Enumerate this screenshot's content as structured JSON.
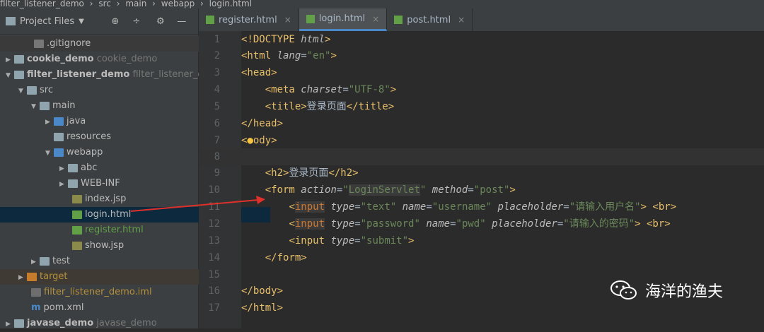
{
  "breadcrumb": {
    "items": [
      "filter_listener_demo",
      "src",
      "main",
      "webapp",
      "login.html"
    ]
  },
  "project_panel": {
    "title": "Project Files",
    "rows": [
      {
        "label": ".gitignore",
        "secondary": ""
      },
      {
        "label": "cookie_demo",
        "secondary": "cookie_demo"
      },
      {
        "label": "filter_listener_demo",
        "secondary": "filter_listener_dem"
      },
      {
        "label": "src",
        "secondary": ""
      },
      {
        "label": "main",
        "secondary": ""
      },
      {
        "label": "java",
        "secondary": ""
      },
      {
        "label": "resources",
        "secondary": ""
      },
      {
        "label": "webapp",
        "secondary": ""
      },
      {
        "label": "abc",
        "secondary": ""
      },
      {
        "label": "WEB-INF",
        "secondary": ""
      },
      {
        "label": "index.jsp",
        "secondary": ""
      },
      {
        "label": "login.html",
        "secondary": ""
      },
      {
        "label": "register.html",
        "secondary": ""
      },
      {
        "label": "show.jsp",
        "secondary": ""
      },
      {
        "label": "test",
        "secondary": ""
      },
      {
        "label": "target",
        "secondary": ""
      },
      {
        "label": "filter_listener_demo.iml",
        "secondary": ""
      },
      {
        "label": "pom.xml",
        "secondary": ""
      },
      {
        "label": "javase_demo",
        "secondary": "javase_demo"
      }
    ]
  },
  "tabs": [
    {
      "label": "register.html"
    },
    {
      "label": "login.html"
    },
    {
      "label": "post.html"
    }
  ],
  "code": {
    "line_numbers": [
      "1",
      "2",
      "3",
      "4",
      "5",
      "6",
      "7",
      "8",
      "9",
      "10",
      "11",
      "12",
      "13",
      "14",
      "15",
      "16",
      "17"
    ],
    "l1_a": "<!DOCTYPE ",
    "l1_b": "html",
    "l1_c": ">",
    "l2_a": "<html ",
    "l2_b": "lang",
    "l2_c": "=",
    "l2_d": "\"en\"",
    "l2_e": ">",
    "l3": "<head>",
    "l4_a": "<meta ",
    "l4_b": "charset",
    "l4_c": "=",
    "l4_d": "\"UTF-8\"",
    "l4_e": ">",
    "l5_a": "<title>",
    "l5_b": "登录页面",
    "l5_c": "</title>",
    "l6": "</head>",
    "l7_a": "<",
    "l7_b": "ody>",
    "l9_a": "<h2>",
    "l9_b": "登录页面",
    "l9_c": "</h2>",
    "l10_a": "<form ",
    "l10_b": "action",
    "l10_c": "=",
    "l10_d": "\"",
    "l10_e": "LoginServlet",
    "l10_f": "\"",
    "l10_g": " method",
    "l10_h": "=",
    "l10_i": "\"post\"",
    "l10_j": ">",
    "l11_a": "<",
    "l11_b": "input",
    "l11_c": " type",
    "l11_d": "=",
    "l11_e": "\"text\"",
    "l11_f": " name",
    "l11_g": "=",
    "l11_h": "\"username\"",
    "l11_i": " placeholder",
    "l11_j": "=",
    "l11_k": "\"请输入用户名\"",
    "l11_l": "> ",
    "l11_m": "<br>",
    "l12_a": "<",
    "l12_b": "input",
    "l12_c": " type",
    "l12_d": "=",
    "l12_e": "\"password\"",
    "l12_f": " name",
    "l12_g": "=",
    "l12_h": "\"pwd\"",
    "l12_i": " placeholder",
    "l12_j": "=",
    "l12_k": "\"请输入的密码\"",
    "l12_l": "> ",
    "l12_m": "<br>",
    "l13_a": "<input ",
    "l13_b": "type",
    "l13_c": "=",
    "l13_d": "\"submit\"",
    "l13_e": ">",
    "l14": "</form>",
    "l16": "</body>",
    "l17": "</html>"
  },
  "watermark": {
    "text": "海洋的渔夫"
  }
}
